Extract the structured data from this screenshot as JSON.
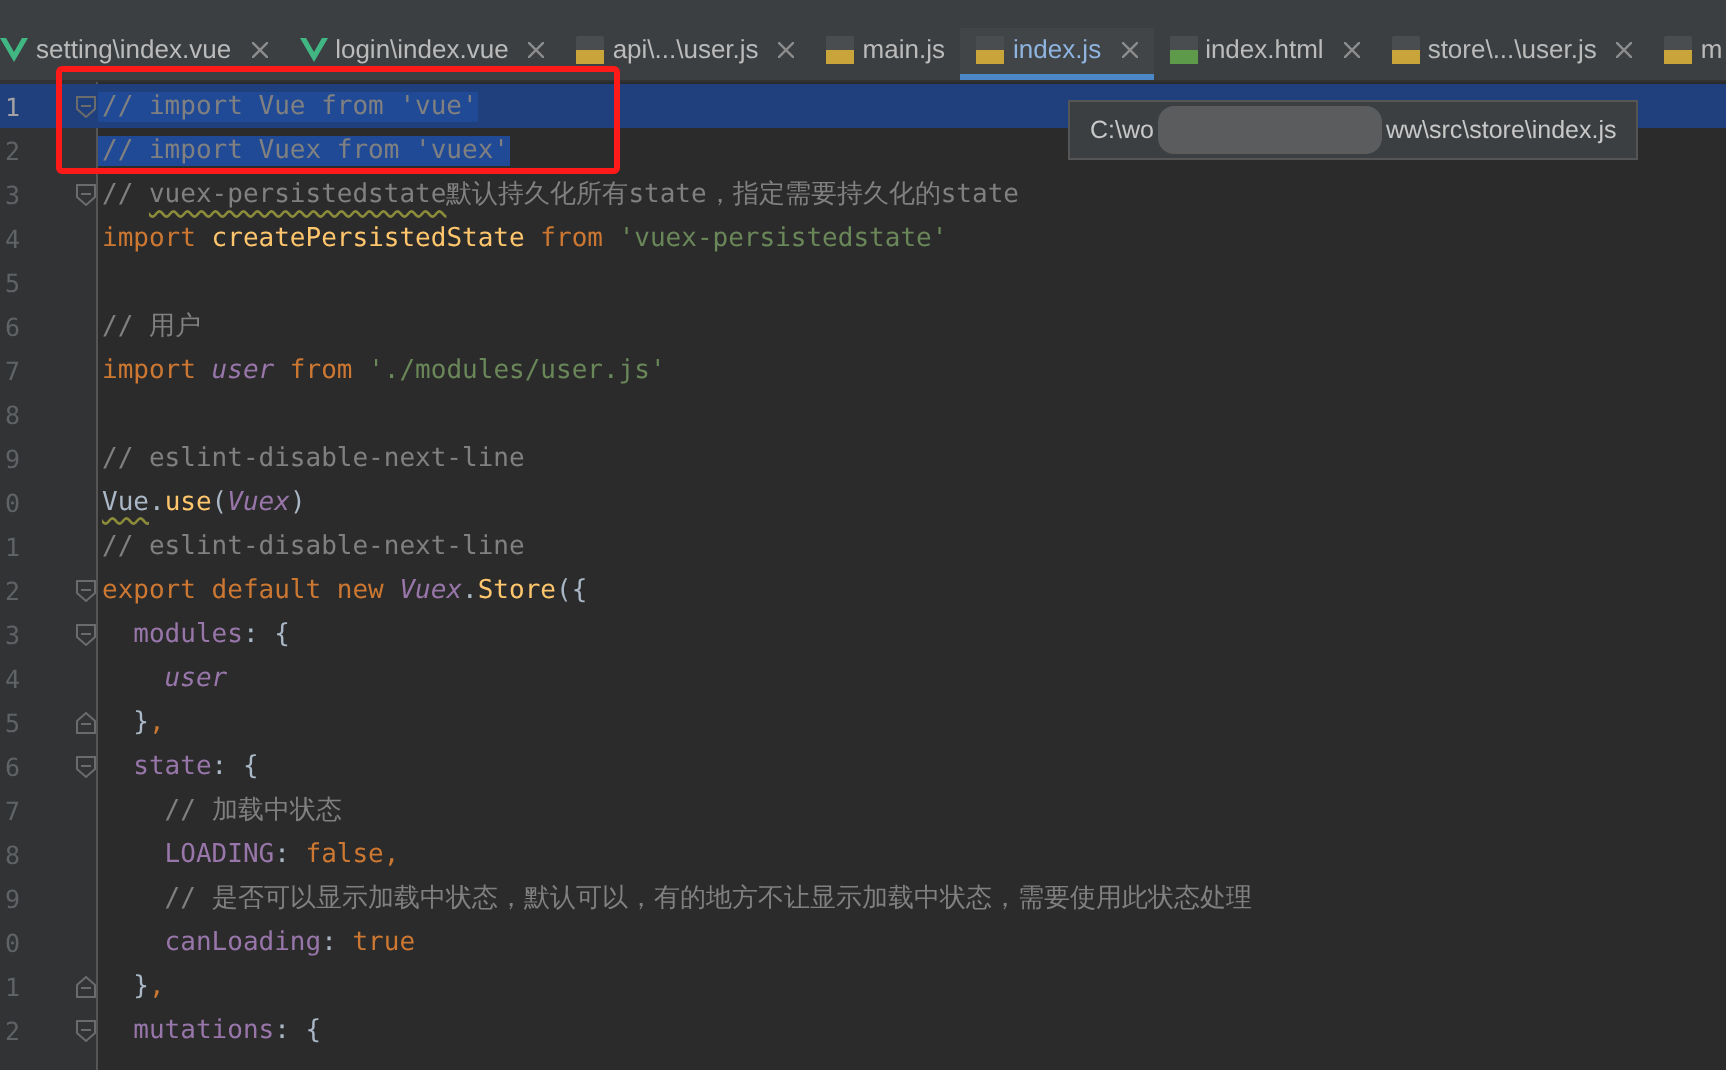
{
  "tabs": [
    {
      "kind": "vue",
      "label": "setting\\index.vue",
      "selected": false,
      "closable": true
    },
    {
      "kind": "vue",
      "label": "login\\index.vue",
      "selected": false,
      "closable": true
    },
    {
      "kind": "js",
      "label": "api\\...\\user.js",
      "selected": false,
      "closable": true
    },
    {
      "kind": "js",
      "label": "main.js",
      "selected": false,
      "closable": false
    },
    {
      "kind": "js",
      "label": "index.js",
      "selected": true,
      "closable": true
    },
    {
      "kind": "html",
      "label": "index.html",
      "selected": false,
      "closable": true
    },
    {
      "kind": "js",
      "label": "store\\...\\user.js",
      "selected": false,
      "closable": true
    },
    {
      "kind": "js",
      "label": "m",
      "selected": false,
      "closable": false
    }
  ],
  "tooltip": {
    "path_start": "C:\\wo",
    "path_end": "ww\\src\\store\\index.js"
  },
  "editor": {
    "lines": [
      {
        "number": "1",
        "fold_start": true,
        "fold_end": false,
        "current": true,
        "selected": true,
        "tokens": [
          {
            "kind": "comment",
            "text": "// import Vue from 'vue'"
          }
        ]
      },
      {
        "number": "2",
        "fold_start": false,
        "fold_end": false,
        "current": false,
        "selected": true,
        "tokens": [
          {
            "kind": "comment",
            "text": "// import Vuex from 'vuex'"
          }
        ]
      },
      {
        "number": "3",
        "fold_start": true,
        "fold_end": false,
        "current": false,
        "selected": false,
        "tokens": [
          {
            "kind": "comment",
            "text": "// "
          },
          {
            "kind": "comment",
            "text": "vuex-persistedstate",
            "squiggle": true
          },
          {
            "kind": "comment",
            "text": "默认持久化所有state，指定需要持久化的state"
          }
        ]
      },
      {
        "number": "4",
        "fold_start": false,
        "fold_end": false,
        "current": false,
        "selected": false,
        "tokens": [
          {
            "kind": "keyword",
            "text": "import "
          },
          {
            "kind": "function",
            "text": "createPersistedState"
          },
          {
            "kind": "keyword",
            "text": " from "
          },
          {
            "kind": "string",
            "text": "'vuex-persistedstate'"
          }
        ]
      },
      {
        "number": "5",
        "fold_start": false,
        "fold_end": false,
        "current": false,
        "selected": false
      },
      {
        "number": "6",
        "fold_start": false,
        "fold_end": false,
        "current": false,
        "selected": false,
        "tokens": [
          {
            "kind": "comment",
            "text": "// 用户"
          }
        ]
      },
      {
        "number": "7",
        "fold_start": false,
        "fold_end": false,
        "current": false,
        "selected": false,
        "tokens": [
          {
            "kind": "keyword",
            "text": "import "
          },
          {
            "kind": "variable",
            "text": "user"
          },
          {
            "kind": "keyword",
            "text": " from "
          },
          {
            "kind": "string",
            "text": "'./modules/user.js'"
          }
        ]
      },
      {
        "number": "8",
        "fold_start": false,
        "fold_end": false,
        "current": false,
        "selected": false
      },
      {
        "number": "9",
        "fold_start": false,
        "fold_end": false,
        "current": false,
        "selected": false,
        "tokens": [
          {
            "kind": "comment",
            "text": "// eslint-disable-next-line"
          }
        ]
      },
      {
        "number": "0",
        "fold_start": false,
        "fold_end": false,
        "current": false,
        "selected": false,
        "tokens": [
          {
            "kind": "plain",
            "text": "Vue",
            "squiggle": true
          },
          {
            "kind": "plain",
            "text": "."
          },
          {
            "kind": "function",
            "text": "use"
          },
          {
            "kind": "plain",
            "text": "("
          },
          {
            "kind": "variable",
            "text": "Vuex"
          },
          {
            "kind": "plain",
            "text": ")"
          }
        ]
      },
      {
        "number": "1",
        "fold_start": false,
        "fold_end": false,
        "current": false,
        "selected": false,
        "tokens": [
          {
            "kind": "comment",
            "text": "// eslint-disable-next-line"
          }
        ]
      },
      {
        "number": "2",
        "fold_start": true,
        "fold_end": false,
        "current": false,
        "selected": false,
        "tokens": [
          {
            "kind": "keyword",
            "text": "export default new "
          },
          {
            "kind": "variable",
            "text": "Vuex"
          },
          {
            "kind": "plain",
            "text": "."
          },
          {
            "kind": "function",
            "text": "Store"
          },
          {
            "kind": "plain",
            "text": "({"
          }
        ]
      },
      {
        "number": "3",
        "fold_start": true,
        "fold_end": false,
        "current": false,
        "selected": false,
        "tokens": [
          {
            "kind": "property",
            "text": "  modules"
          },
          {
            "kind": "plain",
            "text": ": {"
          }
        ]
      },
      {
        "number": "4",
        "fold_start": false,
        "fold_end": false,
        "current": false,
        "selected": false,
        "tokens": [
          {
            "kind": "variable",
            "text": "    user"
          }
        ]
      },
      {
        "number": "5",
        "fold_start": false,
        "fold_end": true,
        "current": false,
        "selected": false,
        "tokens": [
          {
            "kind": "plain",
            "text": "  }"
          },
          {
            "kind": "keyword",
            "text": ","
          }
        ]
      },
      {
        "number": "6",
        "fold_start": true,
        "fold_end": false,
        "current": false,
        "selected": false,
        "tokens": [
          {
            "kind": "property",
            "text": "  state"
          },
          {
            "kind": "plain",
            "text": ": {"
          }
        ]
      },
      {
        "number": "7",
        "fold_start": false,
        "fold_end": false,
        "current": false,
        "selected": false,
        "tokens": [
          {
            "kind": "comment",
            "text": "    // 加载中状态"
          }
        ]
      },
      {
        "number": "8",
        "fold_start": false,
        "fold_end": false,
        "current": false,
        "selected": false,
        "tokens": [
          {
            "kind": "property",
            "text": "    LOADING"
          },
          {
            "kind": "plain",
            "text": ": "
          },
          {
            "kind": "keyword",
            "text": "false,"
          }
        ]
      },
      {
        "number": "9",
        "fold_start": false,
        "fold_end": false,
        "current": false,
        "selected": false,
        "tokens": [
          {
            "kind": "comment",
            "text": "    // 是否可以显示加载中状态，默认可以，有的地方不让显示加载中状态，需要使用此状态处理"
          }
        ]
      },
      {
        "number": "0",
        "fold_start": false,
        "fold_end": false,
        "current": false,
        "selected": false,
        "tokens": [
          {
            "kind": "property",
            "text": "    canLoading"
          },
          {
            "kind": "plain",
            "text": ": "
          },
          {
            "kind": "keyword",
            "text": "true"
          }
        ]
      },
      {
        "number": "1",
        "fold_start": false,
        "fold_end": true,
        "current": false,
        "selected": false,
        "tokens": [
          {
            "kind": "plain",
            "text": "  }"
          },
          {
            "kind": "keyword",
            "text": ","
          }
        ]
      },
      {
        "number": "2",
        "fold_start": true,
        "fold_end": false,
        "current": false,
        "selected": false,
        "tokens": [
          {
            "kind": "property",
            "text": "  mutations"
          },
          {
            "kind": "plain",
            "text": ": {"
          }
        ]
      }
    ]
  }
}
